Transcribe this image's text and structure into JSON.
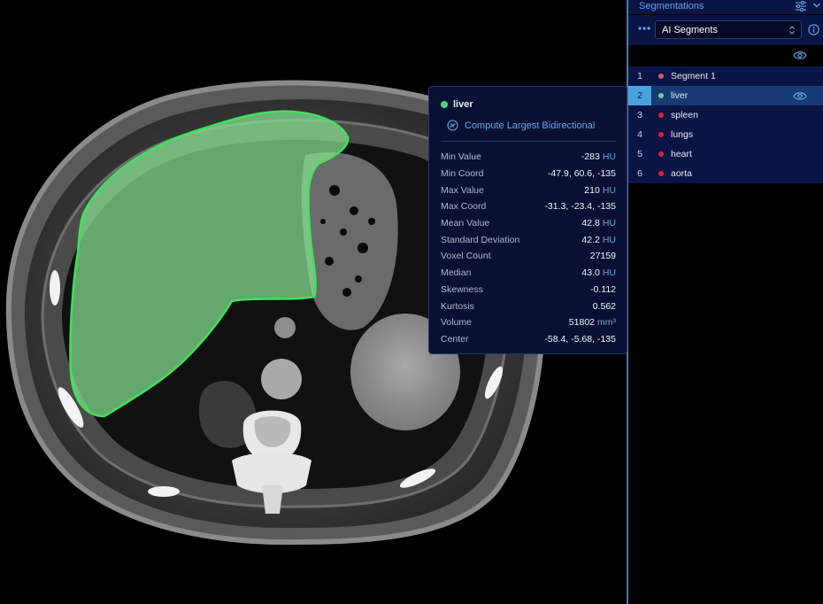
{
  "panel": {
    "title": "Segmentations",
    "select_value": "AI Segments",
    "icons": [
      "filter-icon",
      "chevron-down-icon",
      "more-dots-icon",
      "info-icon",
      "eye-icon"
    ]
  },
  "segments": [
    {
      "num": "1",
      "label": "Segment 1",
      "color": "#e0566b",
      "active": false
    },
    {
      "num": "2",
      "label": "liver",
      "color": "#62d69a",
      "active": true
    },
    {
      "num": "3",
      "label": "spleen",
      "color": "#e0202a",
      "active": false
    },
    {
      "num": "4",
      "label": "lungs",
      "color": "#e0202a",
      "active": false
    },
    {
      "num": "5",
      "label": "heart",
      "color": "#e0202a",
      "active": false
    },
    {
      "num": "6",
      "label": "aorta",
      "color": "#e0202a",
      "active": false
    }
  ],
  "stats": {
    "segment_name": "liver",
    "segment_color": "#4cd87a",
    "compute_label": "Compute Largest Bidirectional",
    "rows": [
      {
        "label": "Min Value",
        "value": "-283",
        "unit": "HU"
      },
      {
        "label": "Min Coord",
        "value": "-47.9, 60.6, -135",
        "unit": ""
      },
      {
        "label": "Max Value",
        "value": "210",
        "unit": "HU"
      },
      {
        "label": "Max Coord",
        "value": "-31.3, -23.4, -135",
        "unit": ""
      },
      {
        "label": "Mean Value",
        "value": "42.8",
        "unit": "HU"
      },
      {
        "label": "Standard Deviation",
        "value": "42.2",
        "unit": "HU"
      },
      {
        "label": "Voxel Count",
        "value": "27159",
        "unit": ""
      },
      {
        "label": "Median",
        "value": "43.0",
        "unit": "HU"
      },
      {
        "label": "Skewness",
        "value": "-0.112",
        "unit": ""
      },
      {
        "label": "Kurtosis",
        "value": "0.562",
        "unit": ""
      },
      {
        "label": "Volume",
        "value": "51802",
        "unit": "mm³"
      },
      {
        "label": "Center",
        "value": "-58.4, -5.68, -135",
        "unit": ""
      }
    ]
  },
  "colors": {
    "accent": "#5fa8e8",
    "panel_bg": "#0b1545",
    "active_row": "#173a74",
    "liver_overlay": "#7ee08e"
  }
}
